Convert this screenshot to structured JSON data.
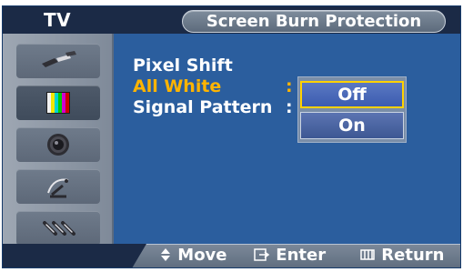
{
  "header": {
    "left_label": "TV",
    "title": "Screen Burn Protection"
  },
  "rail": {
    "items": [
      {
        "name": "input-icon"
      },
      {
        "name": "picture-icon"
      },
      {
        "name": "sound-icon"
      },
      {
        "name": "channel-icon"
      },
      {
        "name": "setup-icon"
      }
    ],
    "active_index": 1
  },
  "menu": {
    "items": [
      {
        "label": "Pixel Shift",
        "highlight": false,
        "show_colon": false
      },
      {
        "label": "All White",
        "highlight": true,
        "show_colon": true
      },
      {
        "label": "Signal Pattern",
        "highlight": false,
        "show_colon": true
      }
    ],
    "colon": ":",
    "dropdown": {
      "options": [
        "Off",
        "On"
      ],
      "selected": "Off"
    }
  },
  "footer": {
    "move": "Move",
    "enter": "Enter",
    "return": "Return"
  },
  "colors": {
    "background": "#2b5e9e",
    "highlight": "#ffb400",
    "selected_border": "#ffd200"
  }
}
